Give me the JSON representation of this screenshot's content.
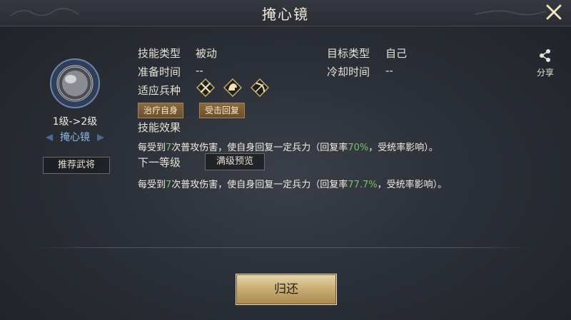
{
  "window": {
    "title": "掩心镜",
    "close_icon": "close-x-icon"
  },
  "skill": {
    "icon": "round-shield-mirror-icon",
    "level_text": "1级->2级",
    "name": "掩心镜",
    "recommend_button": "推荐武将"
  },
  "info": {
    "skill_type_label": "技能类型",
    "skill_type_value": "被动",
    "target_type_label": "目标类型",
    "target_type_value": "自己",
    "prep_time_label": "准备时间",
    "prep_time_value": "--",
    "cooldown_label": "冷却时间",
    "cooldown_value": "--",
    "troop_label": "适应兵种",
    "troops": [
      "infantry-crossed-spears-icon",
      "cavalry-helmet-icon",
      "archer-bow-icon"
    ],
    "tags": [
      "治疗自身",
      "受击回复"
    ]
  },
  "effect": {
    "label": "技能效果",
    "line_prefix": "每受到",
    "line_count": "7",
    "line_mid": "次普攻伤害，使自身回复一定兵力（回复率",
    "current_rate": "70%",
    "line_suffix": "，受统率影响）。"
  },
  "next_level": {
    "label": "下一等级",
    "max_preview_button": "满级预览",
    "line_prefix": "每受到",
    "line_count": "7",
    "line_mid": "次普攻伤害，使自身回复一定兵力（回复率",
    "rate": "77.7%",
    "line_suffix": "，受统率影响）。"
  },
  "share": {
    "icon": "share-icon",
    "label": "分享"
  },
  "footer": {
    "return_button": "归还"
  },
  "colors": {
    "highlight": "#7bc067",
    "skill_name": "#8fb7e6",
    "button_gold": "#c4a86e"
  }
}
